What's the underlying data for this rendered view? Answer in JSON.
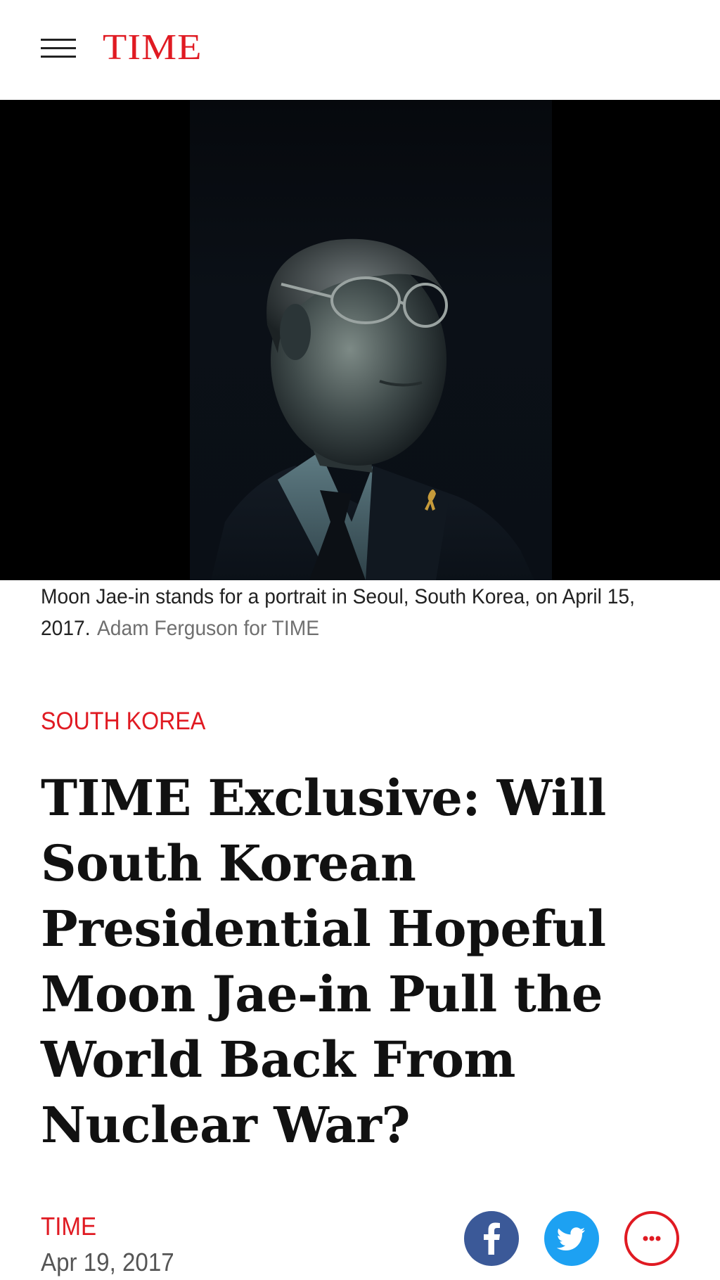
{
  "header": {
    "logo_text": "TIME",
    "menu_icon": "hamburger-menu-icon",
    "brand_color": "#e01a22"
  },
  "hero": {
    "image_description_icon": "portrait-photo"
  },
  "caption": {
    "text": "Moon Jae-in stands for a portrait in Seoul, South Korea, on April 15, 2017.",
    "credit": "Adam Ferguson for TIME"
  },
  "article": {
    "section": "SOUTH KOREA",
    "headline": "TIME Exclusive: Will South Korean Presidential Hopeful Moon Jae-in Pull the World Back From Nuclear War?",
    "author": "TIME",
    "date": "Apr 19, 2017"
  },
  "share": {
    "facebook_icon": "facebook-icon",
    "twitter_icon": "twitter-icon",
    "more_icon": "more-options-icon",
    "facebook_color": "#3b5998",
    "twitter_color": "#1da1f2"
  }
}
